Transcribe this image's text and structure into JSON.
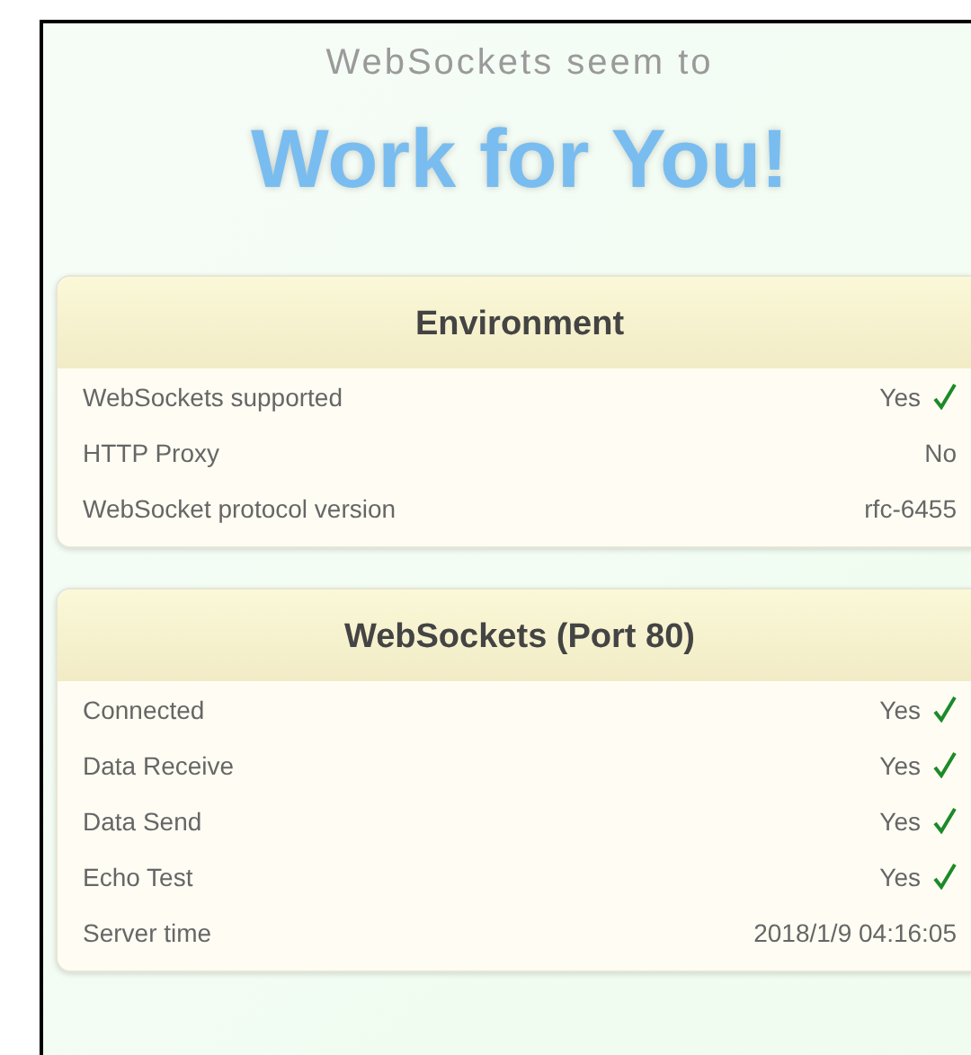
{
  "header": {
    "subtitle": "WebSockets seem to",
    "headline": "Work for You!"
  },
  "sections": [
    {
      "title": "Environment",
      "rows": [
        {
          "label": "WebSockets supported",
          "value": "Yes",
          "ok": true
        },
        {
          "label": "HTTP Proxy",
          "value": "No",
          "ok": false
        },
        {
          "label": "WebSocket protocol version",
          "value": "rfc-6455",
          "ok": false
        }
      ]
    },
    {
      "title": "WebSockets (Port 80)",
      "rows": [
        {
          "label": "Connected",
          "value": "Yes",
          "ok": true
        },
        {
          "label": "Data Receive",
          "value": "Yes",
          "ok": true
        },
        {
          "label": "Data Send",
          "value": "Yes",
          "ok": true
        },
        {
          "label": "Echo Test",
          "value": "Yes",
          "ok": true
        },
        {
          "label": "Server time",
          "value": "2018/1/9 04:16:05",
          "ok": false
        }
      ]
    }
  ]
}
